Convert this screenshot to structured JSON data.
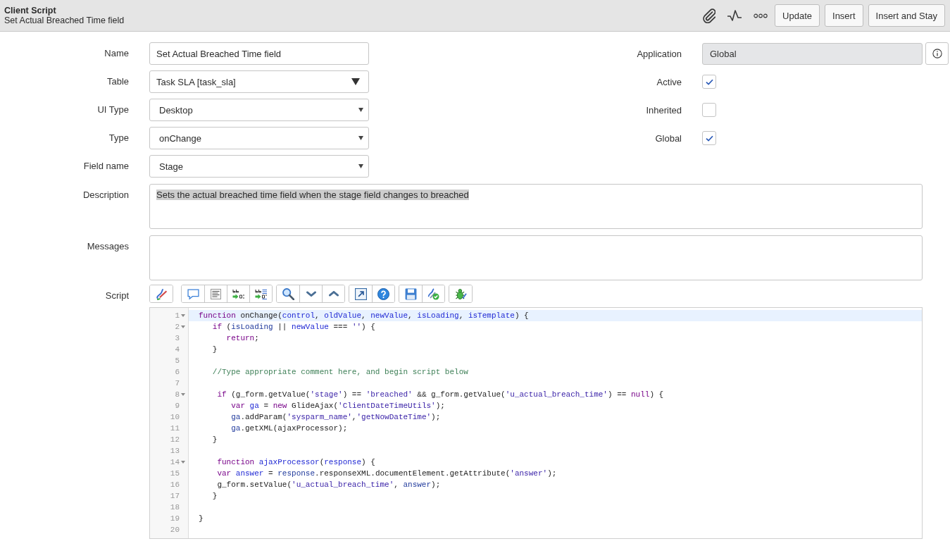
{
  "header": {
    "title": "Client Script",
    "subtitle": "Set Actual Breached Time field",
    "icons": [
      {
        "kind": "paperclip"
      },
      {
        "kind": "pulse"
      },
      {
        "kind": "more"
      }
    ],
    "buttons": [
      "Update",
      "Insert",
      "Insert and Stay"
    ]
  },
  "form": {
    "left_fields": [
      {
        "label": "Name",
        "kind": "text",
        "value": "Set Actual Breached Time field"
      },
      {
        "label": "Table",
        "kind": "reference",
        "value": "Task SLA [task_sla]"
      },
      {
        "label": "UI Type",
        "kind": "choice",
        "value": "Desktop"
      },
      {
        "label": "Type",
        "kind": "choice",
        "value": "onChange"
      },
      {
        "label": "Field name",
        "kind": "choice",
        "value": "Stage"
      }
    ],
    "application": {
      "label": "Application",
      "value": "Global"
    },
    "checkboxes": [
      {
        "label": "Active",
        "checked": true
      },
      {
        "label": "Inherited",
        "checked": false
      },
      {
        "label": "Global",
        "checked": true
      }
    ],
    "description": {
      "label": "Description",
      "value": "Sets the actual breached time field when the stage field changes to breached",
      "highlighted": true
    },
    "messages": {
      "label": "Messages"
    },
    "script": {
      "label": "Script",
      "toolbar": [
        {
          "tools": [
            {
              "kind": "format"
            }
          ]
        },
        {
          "tools": [
            {
              "kind": "comment"
            },
            {
              "kind": "outline"
            },
            {
              "kind": "replace"
            },
            {
              "kind": "replaceall"
            }
          ]
        },
        {
          "tools": [
            {
              "kind": "search"
            },
            {
              "kind": "next"
            },
            {
              "kind": "previous"
            }
          ]
        },
        {
          "tools": [
            {
              "kind": "fullscreen"
            },
            {
              "kind": "help"
            }
          ]
        },
        {
          "tools": [
            {
              "kind": "save"
            },
            {
              "kind": "validate"
            }
          ]
        },
        {
          "tools": [
            {
              "kind": "debug"
            }
          ]
        }
      ],
      "lines": [
        {
          "number": "1",
          "foldable": true,
          "active": true,
          "tokens": [
            {
              "kind": "kw",
              "text": "function"
            },
            {
              "kind": "plain",
              "text": " onChange("
            },
            {
              "kind": "def",
              "text": "control"
            },
            {
              "kind": "plain",
              "text": ", "
            },
            {
              "kind": "def",
              "text": "oldValue"
            },
            {
              "kind": "plain",
              "text": ", "
            },
            {
              "kind": "def",
              "text": "newValue"
            },
            {
              "kind": "plain",
              "text": ", "
            },
            {
              "kind": "def",
              "text": "isLoading"
            },
            {
              "kind": "plain",
              "text": ", "
            },
            {
              "kind": "def",
              "text": "isTemplate"
            },
            {
              "kind": "plain",
              "text": ") {"
            }
          ]
        },
        {
          "number": "2",
          "foldable": true,
          "active": false,
          "tokens": [
            {
              "kind": "kw",
              "text": "   if"
            },
            {
              "kind": "plain",
              "text": " ("
            },
            {
              "kind": "var",
              "text": "isLoading"
            },
            {
              "kind": "plain",
              "text": " || "
            },
            {
              "kind": "def",
              "text": "newValue"
            },
            {
              "kind": "plain",
              "text": " === "
            },
            {
              "kind": "str",
              "text": "''"
            },
            {
              "kind": "plain",
              "text": ") {"
            }
          ]
        },
        {
          "number": "3",
          "foldable": false,
          "active": false,
          "tokens": [
            {
              "kind": "kw",
              "text": "      return"
            },
            {
              "kind": "plain",
              "text": ";"
            }
          ]
        },
        {
          "number": "4",
          "foldable": false,
          "active": false,
          "tokens": [
            {
              "kind": "plain",
              "text": "   }"
            }
          ]
        },
        {
          "number": "5",
          "foldable": false,
          "active": false
        },
        {
          "number": "6",
          "foldable": false,
          "active": false,
          "tokens": [
            {
              "kind": "cmt",
              "text": "   //Type appropriate comment here, and begin script below"
            }
          ]
        },
        {
          "number": "7",
          "foldable": false,
          "active": false
        },
        {
          "number": "8",
          "foldable": true,
          "active": false,
          "tokens": [
            {
              "kind": "kw",
              "text": "    if"
            },
            {
              "kind": "plain",
              "text": " (g_form.getValue("
            },
            {
              "kind": "str",
              "text": "'stage'"
            },
            {
              "kind": "plain",
              "text": ") == "
            },
            {
              "kind": "str",
              "text": "'breached'"
            },
            {
              "kind": "plain",
              "text": " && g_form.getValue("
            },
            {
              "kind": "str",
              "text": "'u_actual_breach_time'"
            },
            {
              "kind": "plain",
              "text": ") == "
            },
            {
              "kind": "kw",
              "text": "null"
            },
            {
              "kind": "plain",
              "text": ") {"
            }
          ]
        },
        {
          "number": "9",
          "foldable": false,
          "active": false,
          "tokens": [
            {
              "kind": "kw",
              "text": "       var"
            },
            {
              "kind": "def",
              "text": " ga"
            },
            {
              "kind": "plain",
              "text": " = "
            },
            {
              "kind": "kw",
              "text": "new"
            },
            {
              "kind": "plain",
              "text": " GlideAjax("
            },
            {
              "kind": "str",
              "text": "'ClientDateTimeUtils'"
            },
            {
              "kind": "plain",
              "text": ");"
            }
          ]
        },
        {
          "number": "10",
          "foldable": false,
          "active": false,
          "tokens": [
            {
              "kind": "var",
              "text": "       ga"
            },
            {
              "kind": "plain",
              "text": ".addParam("
            },
            {
              "kind": "str",
              "text": "'sysparm_name'"
            },
            {
              "kind": "plain",
              "text": ","
            },
            {
              "kind": "str",
              "text": "'getNowDateTime'"
            },
            {
              "kind": "plain",
              "text": ");"
            }
          ]
        },
        {
          "number": "11",
          "foldable": false,
          "active": false,
          "tokens": [
            {
              "kind": "var",
              "text": "       ga"
            },
            {
              "kind": "plain",
              "text": ".getXML(ajaxProcessor);"
            }
          ]
        },
        {
          "number": "12",
          "foldable": false,
          "active": false,
          "tokens": [
            {
              "kind": "plain",
              "text": "   }"
            }
          ]
        },
        {
          "number": "13",
          "foldable": false,
          "active": false
        },
        {
          "number": "14",
          "foldable": true,
          "active": false,
          "tokens": [
            {
              "kind": "kw",
              "text": "    function"
            },
            {
              "kind": "def",
              "text": " ajaxProcessor"
            },
            {
              "kind": "plain",
              "text": "("
            },
            {
              "kind": "def",
              "text": "response"
            },
            {
              "kind": "plain",
              "text": ") {"
            }
          ]
        },
        {
          "number": "15",
          "foldable": false,
          "active": false,
          "tokens": [
            {
              "kind": "kw",
              "text": "    var"
            },
            {
              "kind": "def",
              "text": " answer"
            },
            {
              "kind": "plain",
              "text": " = "
            },
            {
              "kind": "var",
              "text": "response"
            },
            {
              "kind": "plain",
              "text": ".responseXML.documentElement.getAttribute("
            },
            {
              "kind": "str",
              "text": "'answer'"
            },
            {
              "kind": "plain",
              "text": ");"
            }
          ]
        },
        {
          "number": "16",
          "foldable": false,
          "active": false,
          "tokens": [
            {
              "kind": "plain",
              "text": "    g_form.setValue("
            },
            {
              "kind": "str",
              "text": "'u_actual_breach_time'"
            },
            {
              "kind": "plain",
              "text": ", "
            },
            {
              "kind": "var",
              "text": "answer"
            },
            {
              "kind": "plain",
              "text": ");"
            }
          ]
        },
        {
          "number": "17",
          "foldable": false,
          "active": false,
          "tokens": [
            {
              "kind": "plain",
              "text": "   }"
            }
          ]
        },
        {
          "number": "18",
          "foldable": false,
          "active": false
        },
        {
          "number": "19",
          "foldable": false,
          "active": false,
          "tokens": [
            {
              "kind": "plain",
              "text": "}"
            }
          ]
        },
        {
          "number": "20",
          "foldable": false,
          "active": false
        }
      ]
    }
  }
}
